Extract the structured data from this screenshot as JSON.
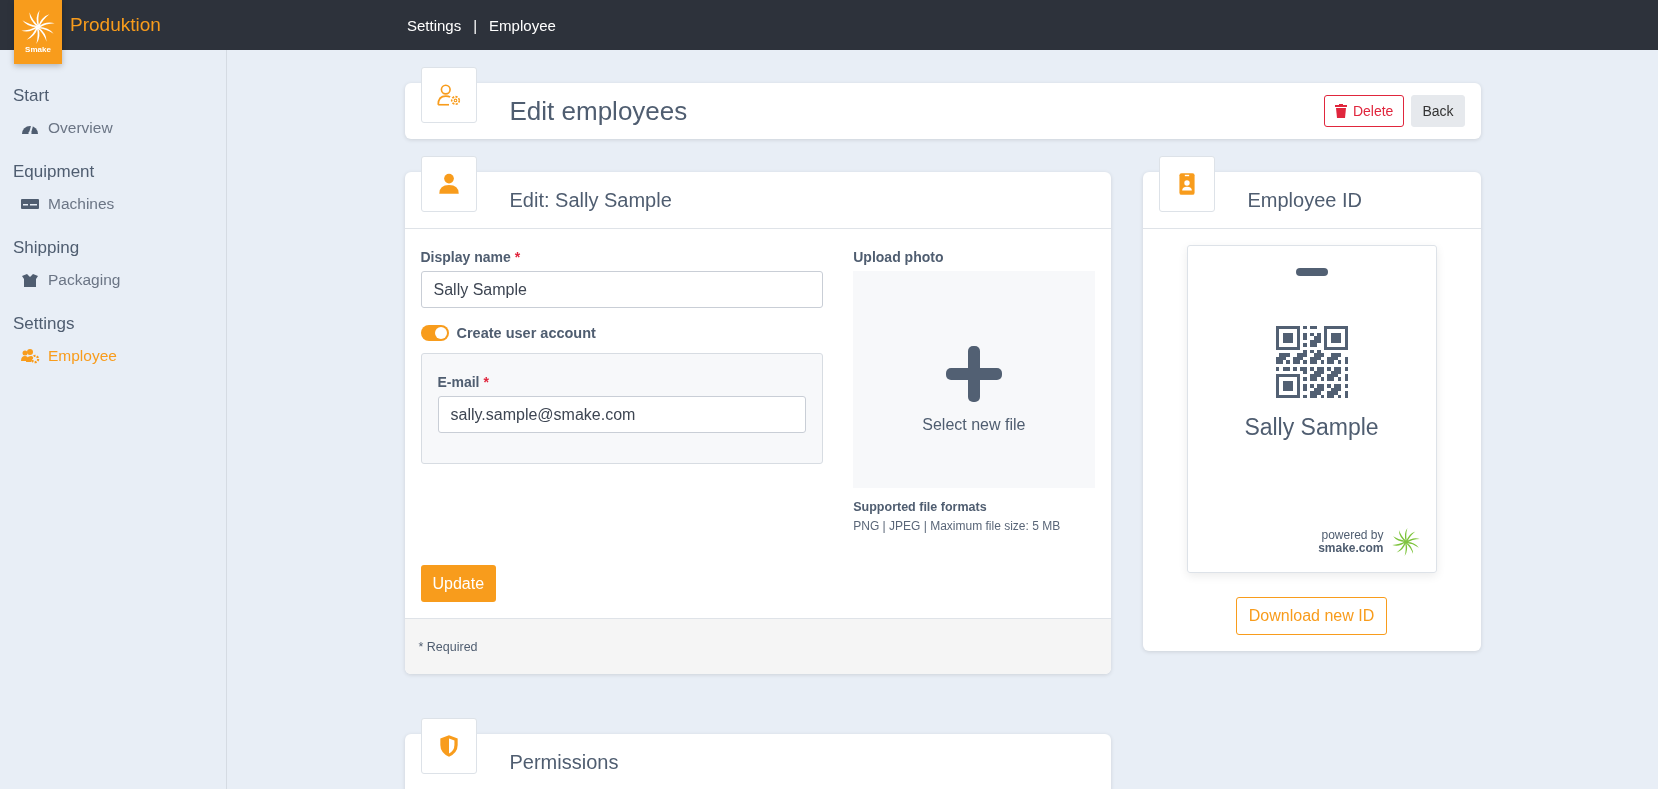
{
  "app": {
    "logo_text": "Smake",
    "name": "Produktion"
  },
  "breadcrumbs": {
    "items": [
      "Settings",
      "Employee"
    ],
    "separator": "|"
  },
  "sidebar": {
    "sections": [
      {
        "title": "Start",
        "items": [
          {
            "label": "Overview",
            "selected": false
          }
        ]
      },
      {
        "title": "Equipment",
        "items": [
          {
            "label": "Machines",
            "selected": false
          }
        ]
      },
      {
        "title": "Shipping",
        "items": [
          {
            "label": "Packaging",
            "selected": false
          }
        ]
      },
      {
        "title": "Settings",
        "items": [
          {
            "label": "Employee",
            "selected": true
          }
        ]
      }
    ]
  },
  "page_header": {
    "title": "Edit employees",
    "buttons": [
      {
        "label": "Delete",
        "kind": "danger"
      },
      {
        "label": "Back",
        "kind": "secondary"
      }
    ]
  },
  "edit_card": {
    "title": "Edit: Sally Sample",
    "display_name": {
      "label": "Display name",
      "required_mark": "*",
      "value": "Sally Sample"
    },
    "toggle": {
      "label": "Create user account",
      "on": true
    },
    "email": {
      "label": "E-mail",
      "required_mark": "*",
      "value": "sally.sample@smake.com"
    },
    "upload": {
      "label": "Upload photo",
      "button": "Select new file",
      "formats_title": "Supported file formats",
      "formats_text": "PNG | JPEG | Maximum file size: 5 MB"
    },
    "submit": "Update",
    "footer_note": "* Required"
  },
  "id_card": {
    "title": "Employee ID",
    "name": "Sally Sample",
    "powered_by": "powered by",
    "domain": "smake.com",
    "download": "Download new ID"
  },
  "permissions": {
    "title": "Permissions"
  }
}
